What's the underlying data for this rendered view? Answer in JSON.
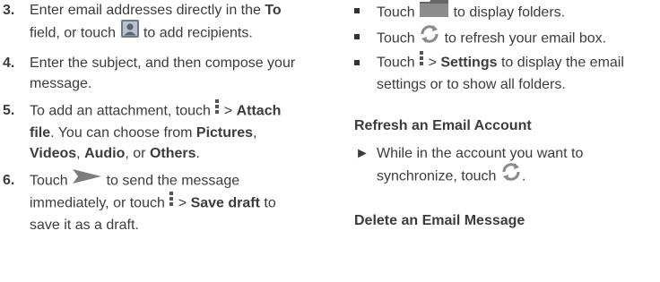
{
  "left": {
    "steps": [
      {
        "num": "3.",
        "t1": "Enter email addresses directly in the ",
        "b1": "To",
        "t2": " field, or touch ",
        "icon": "contact-picker-icon",
        "t3": " to add recipients."
      },
      {
        "num": "4.",
        "t1": "Enter the subject, and then compose your message."
      },
      {
        "num": "5.",
        "t1": "To add an attachment, touch ",
        "icon": "menu-dots-icon",
        "t2": " > ",
        "b1": "Attach file",
        "t3": ". You can choose from ",
        "b2": "Pictures",
        "t4": ", ",
        "b3": "Videos",
        "t5": ", ",
        "b4": "Audio",
        "t6": ", or ",
        "b5": "Others",
        "t7": "."
      },
      {
        "num": "6.",
        "t1": "Touch ",
        "icon1": "send-arrow-icon",
        "t2": " to send the message immediately, or touch ",
        "icon2": "menu-dots-icon",
        "t3": " > ",
        "b1": "Save draft",
        "t4": " to save it as a draft."
      }
    ]
  },
  "right": {
    "bullets": [
      {
        "t1": "Touch ",
        "icon": "folder-icon",
        "t2": " to display folders."
      },
      {
        "t1": "Touch ",
        "icon": "refresh-icon",
        "t2": " to refresh your email box."
      },
      {
        "t1": "Touch ",
        "icon": "menu-dots-icon",
        "t2": " > ",
        "b1": "Settings",
        "t3": " to display the email settings or to show all folders."
      }
    ],
    "sections": [
      {
        "heading": "Refresh an Email Account",
        "arrow": "►",
        "t1": "While in the account you want to synchronize, touch ",
        "icon": "refresh-icon",
        "t2": "."
      },
      {
        "heading": "Delete an Email Message"
      }
    ]
  },
  "colors": {
    "text": "#3c3c3c",
    "icon_gray": "#8a8a8a",
    "icon_dark": "#555555"
  }
}
